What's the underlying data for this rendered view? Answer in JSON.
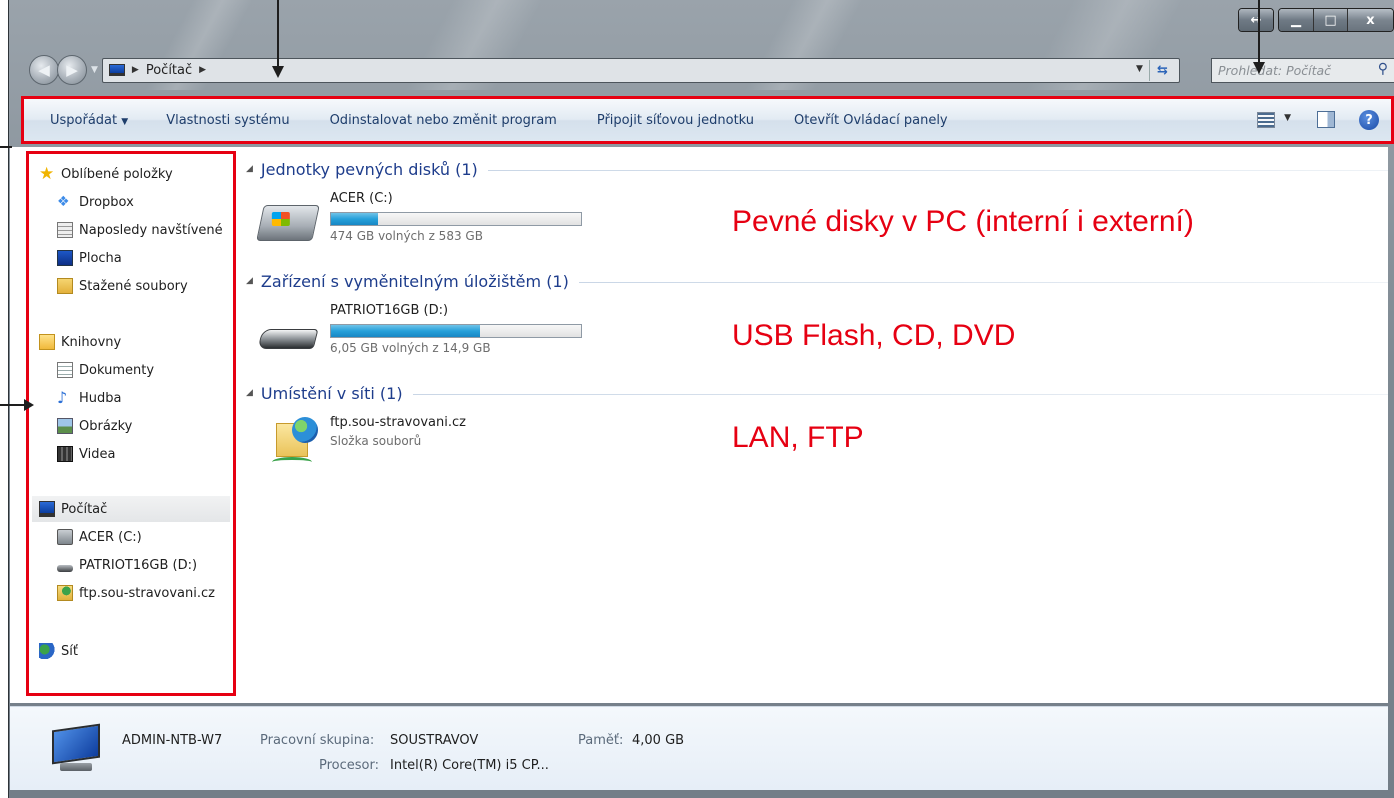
{
  "window": {
    "caption_buttons": [
      {
        "name": "snap",
        "glyph": "↔"
      },
      {
        "name": "minimize",
        "glyph": "▁"
      },
      {
        "name": "maximize",
        "glyph": "□"
      },
      {
        "name": "close",
        "glyph": "x"
      }
    ]
  },
  "address": {
    "back_glyph": "◀",
    "forward_glyph": "▶",
    "crumb": "Počítač",
    "dropdown_glyph": "▼",
    "refresh_glyph": "⇆",
    "search_placeholder": "Prohledat: Počítač"
  },
  "toolbar": {
    "organize": "Uspořádat",
    "organize_arrow": "▼",
    "system_properties": "Vlastnosti systému",
    "uninstall": "Odinstalovat nebo změnit program",
    "map_drive": "Připojit síťovou jednotku",
    "control_panel": "Otevřít Ovládací panely",
    "help": "?"
  },
  "nav": {
    "favorites": "Oblíbené položky",
    "dropbox": "Dropbox",
    "recent": "Naposledy navštívené",
    "desktop": "Plocha",
    "downloads": "Stažené soubory",
    "libraries": "Knihovny",
    "documents": "Dokumenty",
    "music": "Hudba",
    "pictures": "Obrázky",
    "videos": "Videa",
    "computer": "Počítač",
    "drive_c": "ACER (C:)",
    "drive_d": "PATRIOT16GB (D:)",
    "ftp": "ftp.sou-stravovani.cz",
    "network": "Síť"
  },
  "content": {
    "groups": [
      {
        "title": "Jednotky pevných disků (1)"
      },
      {
        "title": "Zařízení s vyměnitelným úložištěm (1)"
      },
      {
        "title": "Umístění v síti (1)"
      }
    ],
    "drives": [
      {
        "name": "ACER (C:)",
        "free_text": "474 GB volných z 583 GB",
        "used_fraction": 0.187
      },
      {
        "name": "PATRIOT16GB (D:)",
        "free_text": "6,05 GB volných z 14,9 GB",
        "used_fraction": 0.594
      }
    ],
    "network_location": {
      "name": "ftp.sou-stravovani.cz",
      "type": "Složka souborů"
    }
  },
  "annotations": {
    "fixed_disks": "Pevné disky v PC (interní i externí)",
    "removable": "USB Flash, CD, DVD",
    "network": "LAN, FTP"
  },
  "details": {
    "computer_name": "ADMIN-NTB-W7",
    "workgroup_label": "Pracovní skupina:",
    "workgroup": "SOUSTRAVOV",
    "memory_label": "Paměť:",
    "memory": "4,00 GB",
    "processor_label": "Procesor:",
    "processor": "Intel(R) Core(TM) i5 CP..."
  },
  "colors": {
    "highlight_red": "#e60012",
    "bar_fill": "#26a0da",
    "group_title": "#1e3d8c"
  }
}
